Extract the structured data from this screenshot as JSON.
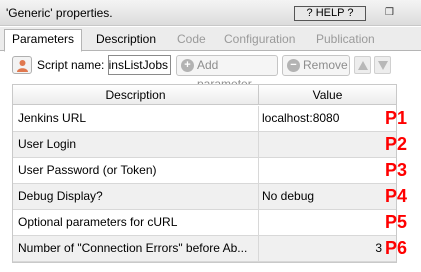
{
  "window": {
    "title": "'Generic' properties.",
    "help_label": "? HELP ?",
    "restore_icon": "restore-icon"
  },
  "tabs": [
    {
      "label": "Parameters",
      "state": "active"
    },
    {
      "label": "Description",
      "state": "enabled"
    },
    {
      "label": "Code",
      "state": "disabled"
    },
    {
      "label": "Configuration",
      "state": "disabled"
    },
    {
      "label": "Publication",
      "state": "disabled"
    }
  ],
  "toolbar": {
    "script_label": "Script name:",
    "script_name": "JenkinsListJobs",
    "add_label": "Add parameter",
    "remove_label": "Remove",
    "add_icon": "+",
    "remove_icon": "−"
  },
  "grid": {
    "headers": [
      "Description",
      "Value"
    ],
    "rows": [
      {
        "description": "Jenkins URL",
        "value": "localhost:8080",
        "marker": "P1"
      },
      {
        "description": "User Login",
        "value": "",
        "marker": "P2"
      },
      {
        "description": "User Password (or Token)",
        "value": "",
        "marker": "P3"
      },
      {
        "description": "Debug Display?",
        "value": "No debug",
        "marker": "P4"
      },
      {
        "description": "Optional parameters for cURL",
        "value": "",
        "marker": "P5"
      },
      {
        "description": "Number of \"Connection Errors\" before Ab...",
        "value": "3",
        "marker": "P6"
      }
    ]
  },
  "colors": {
    "marker": "#ff0000",
    "alt_row": "#f0f0f0"
  }
}
